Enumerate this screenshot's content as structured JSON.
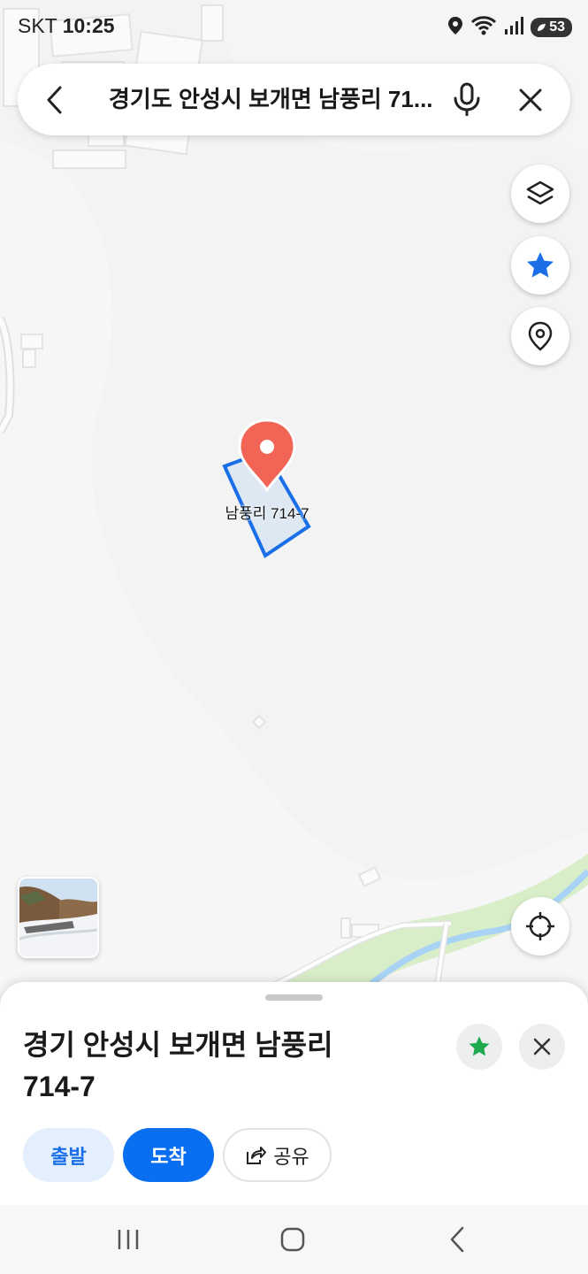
{
  "status_bar": {
    "carrier": "SKT",
    "time": "10:25",
    "battery": "53",
    "icons": [
      "location-icon",
      "wifi-icon",
      "signal-icon",
      "battery-icon"
    ]
  },
  "search": {
    "query": "경기도 안성시 보개면 남풍리 71...",
    "icons": [
      "back-icon",
      "mic-icon",
      "close-icon"
    ]
  },
  "map": {
    "pin_label": "남풍리 714-7",
    "colors": {
      "pin": "#f26455",
      "parcel_border": "#1a6ee8",
      "parcel_fill": "#dde8f3",
      "stream": "#a9d3f5",
      "riverbank": "#d8eec8",
      "background": "#f3f3f3"
    }
  },
  "map_controls": {
    "icons": [
      "layers-icon",
      "favorite-star-icon",
      "place-pin-icon",
      "my-location-icon"
    ],
    "accent": "#1a6ee8"
  },
  "place_sheet": {
    "title_line1": "경기 안성시 보개면 남풍리",
    "title_line2": "714-7",
    "save_star_color": "#1fa94f",
    "buttons": {
      "departure": "출발",
      "arrival": "도착",
      "share": "공유"
    },
    "colors": {
      "departure_bg": "#e3effd",
      "departure_text": "#1a6ee8",
      "arrival_bg": "#0a6ef0",
      "arrival_text": "#ffffff"
    }
  },
  "nav_bar": {
    "icons": [
      "recent-apps-icon",
      "home-icon",
      "back-nav-icon"
    ]
  }
}
